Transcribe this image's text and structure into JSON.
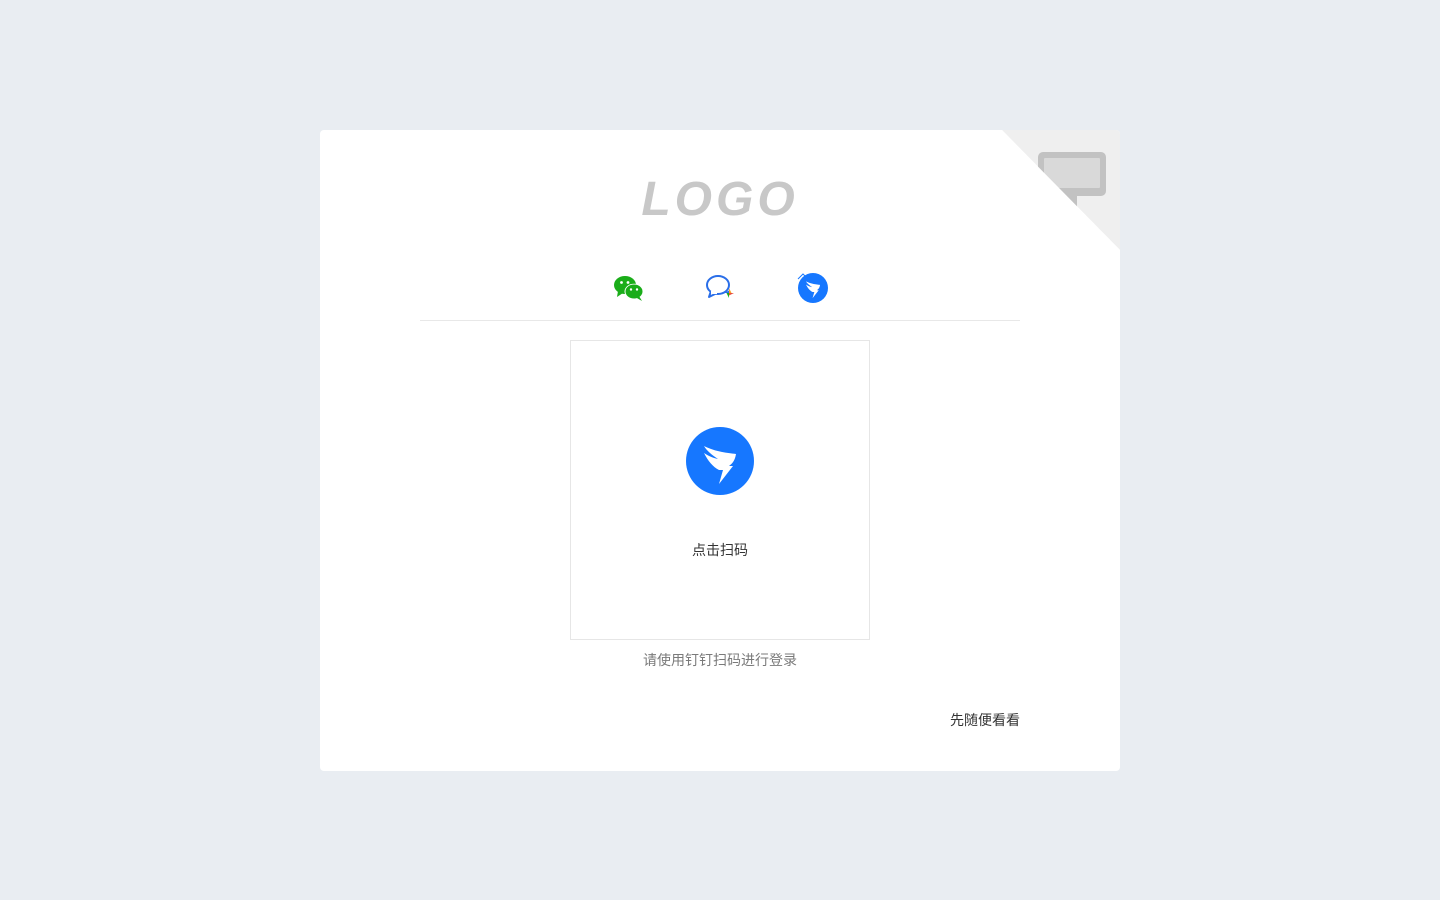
{
  "logo": {
    "text": "LOGO"
  },
  "tabs": [
    {
      "id": "wechat",
      "icon": "wechat-icon",
      "color": "#1aad19",
      "active": false
    },
    {
      "id": "wecom",
      "icon": "wecom-icon",
      "color": "#2a6ee8",
      "active": false
    },
    {
      "id": "dingtalk",
      "icon": "dingtalk-icon",
      "color": "#1677ff",
      "active": true
    }
  ],
  "qr": {
    "icon": "dingtalk-icon",
    "label": "点击扫码"
  },
  "hint": "请使用钉钉扫码进行登录",
  "browse_link": "先随便看看",
  "corner": {
    "icon": "monitor-icon"
  },
  "colors": {
    "background": "#e9edf2",
    "card": "#ffffff",
    "accent": "#1677ff"
  }
}
